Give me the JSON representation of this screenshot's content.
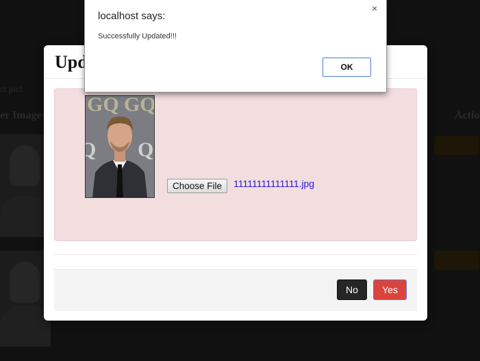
{
  "background": {
    "note": "ct pic!",
    "column_left": "er Image",
    "column_right": "Actio"
  },
  "modal": {
    "title": "Upd",
    "image_panel": {
      "choose_file_label": "Choose File",
      "file_name": "11111111111111.jpg"
    },
    "footer": {
      "no_label": "No",
      "yes_label": "Yes"
    }
  },
  "alert": {
    "title": "localhost says:",
    "close_glyph": "×",
    "message": "Successfully Updated!!!",
    "ok_label": "OK"
  },
  "colors": {
    "panel_bg": "#f2dede",
    "yes_button": "#d9443e",
    "no_button": "#262626",
    "file_link": "#2a15d8",
    "ok_border": "#4a7bd6"
  },
  "icons": {
    "alert_close": "close-icon"
  }
}
